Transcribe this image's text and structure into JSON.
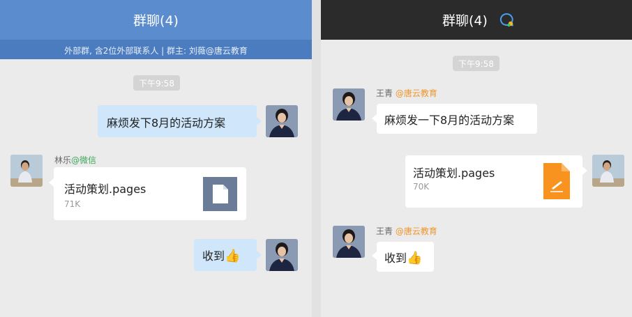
{
  "left_panel": {
    "title": "群聊(4)",
    "subtitle": "外部群, 含2位外部联系人 | 群主: 刘薇@唐云教育",
    "timestamp": "下午9:58",
    "messages": {
      "m1_text": "麻烦发下8月的活动方案",
      "m2_sender_name": "林乐",
      "m2_sender_tag": "@微信",
      "m2_file_name": "活动策划.pages",
      "m2_file_size": "71K",
      "m3_text": "收到"
    }
  },
  "right_panel": {
    "title": "群聊(4)",
    "timestamp": "下午9:58",
    "messages": {
      "m1_sender_name": "王青",
      "m1_sender_tag": "@唐云教育",
      "m1_text": "麻烦发一下8月的活动方案",
      "m2_file_name": "活动策划.pages",
      "m2_file_size": "70K",
      "m3_sender_name": "王青",
      "m3_sender_tag": "@唐云教育",
      "m3_text": "收到"
    }
  },
  "icons": {
    "thumbs_up": "👍",
    "chat_icon": "chat-bubble-plus-icon",
    "file_icon_gray": "document-icon",
    "file_icon_orange": "pages-file-icon"
  },
  "colors": {
    "left_nav": "#5b8ccd",
    "left_subbar": "#4a7cbf",
    "right_nav": "#2b2b2b",
    "my_bubble": "#cfe6fb",
    "other_bubble": "#ffffff",
    "tag_green": "#3ea85b",
    "tag_orange": "#f0962b",
    "file_gray": "#6b7c99",
    "file_orange": "#f7931e"
  }
}
